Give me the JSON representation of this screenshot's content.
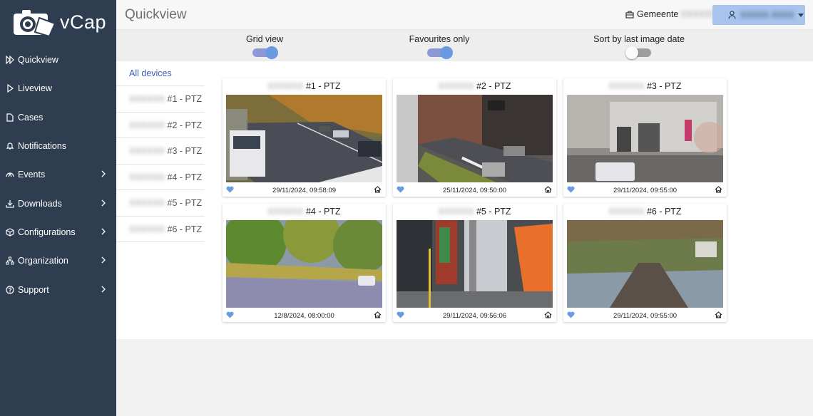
{
  "app": {
    "name": "vCap"
  },
  "header": {
    "title": "Quickview",
    "gemeente_label": "Gemeente",
    "gemeente_value": "XXXXXX",
    "user_name": "XXXXX XXXX"
  },
  "sidebar": {
    "items": [
      {
        "label": "Quickview",
        "icon": "quickview-icon",
        "has_chevron": false
      },
      {
        "label": "Liveview",
        "icon": "play-icon",
        "has_chevron": false
      },
      {
        "label": "Cases",
        "icon": "document-icon",
        "has_chevron": false
      },
      {
        "label": "Notifications",
        "icon": "bell-icon",
        "has_chevron": false
      },
      {
        "label": "Events",
        "icon": "events-icon",
        "has_chevron": true
      },
      {
        "label": "Downloads",
        "icon": "download-icon",
        "has_chevron": true
      },
      {
        "label": "Configurations",
        "icon": "box-icon",
        "has_chevron": true
      },
      {
        "label": "Organization",
        "icon": "org-icon",
        "has_chevron": true
      },
      {
        "label": "Support",
        "icon": "help-icon",
        "has_chevron": true
      }
    ]
  },
  "controls": {
    "grid_view": {
      "label": "Grid view",
      "on": true
    },
    "favourites_only": {
      "label": "Favourites only",
      "on": true
    },
    "sort_by_date": {
      "label": "Sort by last image date",
      "on": false
    }
  },
  "devices": {
    "all_label": "All devices",
    "items": [
      {
        "prefix": "XXXXXX",
        "label": "#1 - PTZ"
      },
      {
        "prefix": "XXXXXX",
        "label": "#2 - PTZ"
      },
      {
        "prefix": "XXXXXX",
        "label": "#3 - PTZ"
      },
      {
        "prefix": "XXXXXX",
        "label": "#4 - PTZ"
      },
      {
        "prefix": "XXXXXX",
        "label": "#5 - PTZ"
      },
      {
        "prefix": "XXXXXX",
        "label": "#6 - PTZ"
      }
    ]
  },
  "cameras": [
    {
      "prefix": "XXXXXX",
      "label": "#1 - PTZ",
      "timestamp": "29/11/2024, 09:58:09",
      "favourite": true
    },
    {
      "prefix": "XXXXXX",
      "label": "#2 - PTZ",
      "timestamp": "25/11/2024, 09:50:00",
      "favourite": true
    },
    {
      "prefix": "XXXXXX",
      "label": "#3 - PTZ",
      "timestamp": "29/11/2024, 09:55:00",
      "favourite": true
    },
    {
      "prefix": "XXXXXX",
      "label": "#4 - PTZ",
      "timestamp": "12/8/2024, 08:00:00",
      "favourite": true
    },
    {
      "prefix": "XXXXXX",
      "label": "#5 - PTZ",
      "timestamp": "29/11/2024, 09:56:06",
      "favourite": true
    },
    {
      "prefix": "XXXXXX",
      "label": "#6 - PTZ",
      "timestamp": "29/11/2024, 09:55:00",
      "favourite": true
    }
  ],
  "colors": {
    "sidebar_bg": "#2e3e50",
    "accent": "#3b5bb5",
    "user_button": "#a6c4ee",
    "favourite": "#6a9ae0"
  }
}
